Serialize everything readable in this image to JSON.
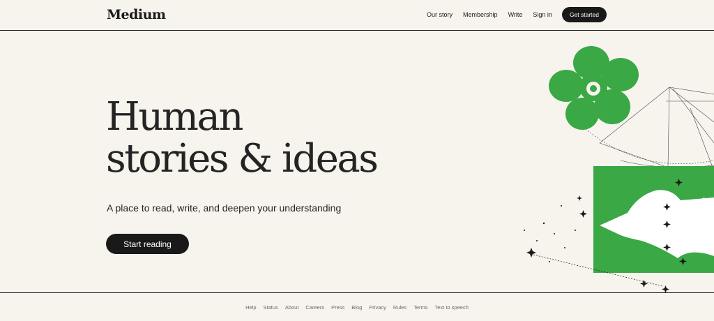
{
  "header": {
    "logo": "Medium",
    "nav": [
      "Our story",
      "Membership",
      "Write",
      "Sign in"
    ],
    "cta": "Get started"
  },
  "hero": {
    "line1": "Human",
    "line2": "stories & ideas",
    "subtitle": "A place to read, write, and deepen your understanding",
    "button": "Start reading"
  },
  "footer": {
    "links": [
      "Help",
      "Status",
      "About",
      "Careers",
      "Press",
      "Blog",
      "Privacy",
      "Rules",
      "Terms",
      "Text to speech"
    ]
  },
  "colors": {
    "background": "#f7f4ed",
    "accent": "#3aa845",
    "dark": "#191919"
  }
}
